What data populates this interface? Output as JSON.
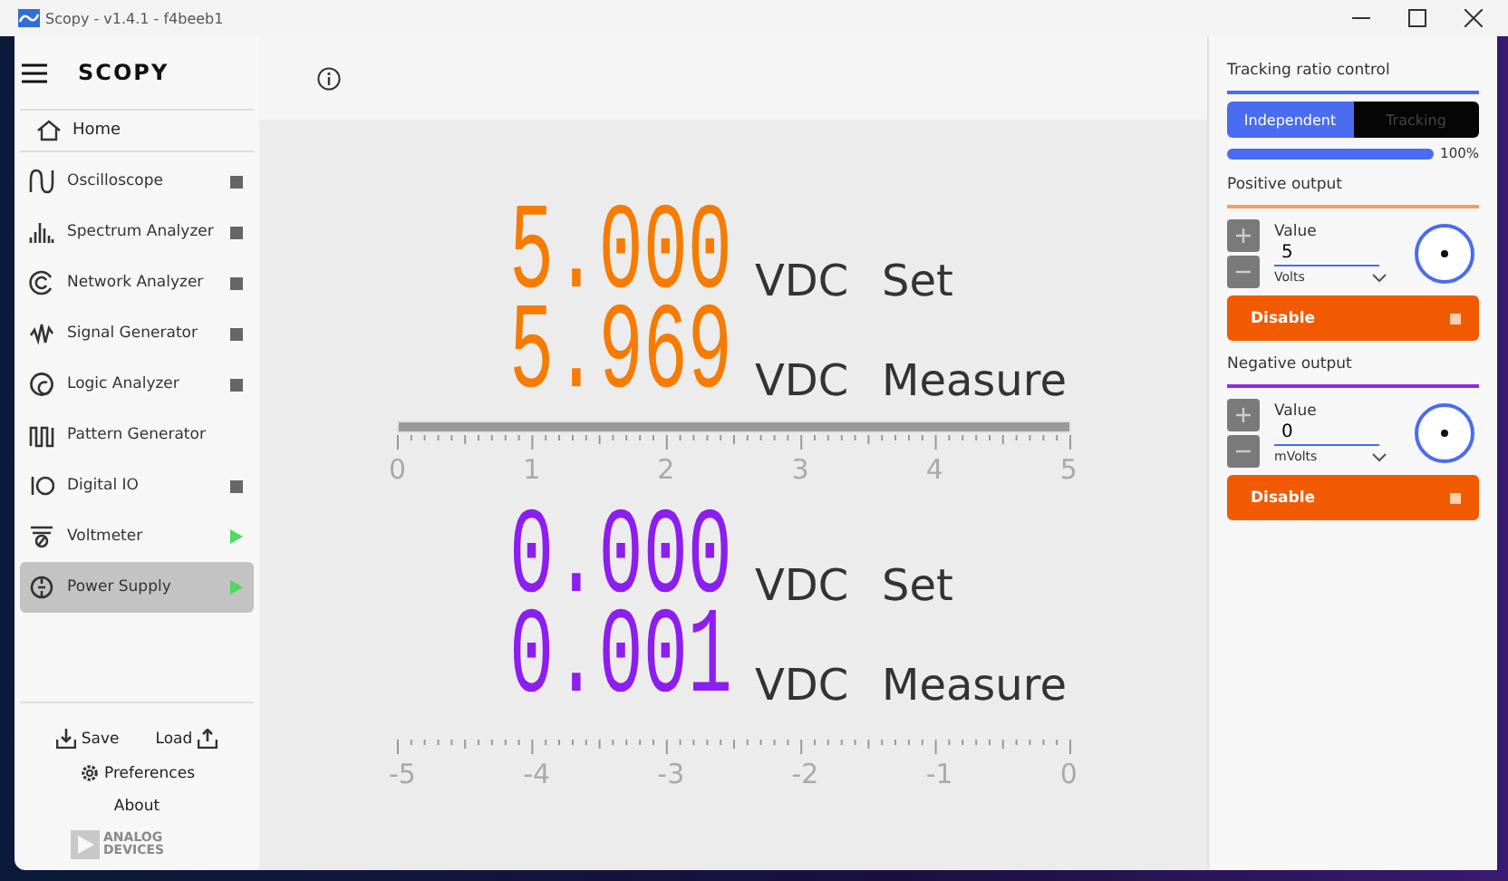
{
  "window": {
    "title": "Scopy - v1.4.1 - f4beeb1"
  },
  "sidebar": {
    "logo": "SCOPY",
    "home": "Home",
    "items": [
      {
        "label": "Oscilloscope",
        "kind": "stopped",
        "selected": false
      },
      {
        "label": "Spectrum Analyzer",
        "kind": "stopped",
        "selected": false
      },
      {
        "label": "Network Analyzer",
        "kind": "stopped",
        "selected": false
      },
      {
        "label": "Signal Generator",
        "kind": "stopped",
        "selected": false
      },
      {
        "label": "Logic Analyzer",
        "kind": "stopped",
        "selected": false
      },
      {
        "label": "Pattern Generator",
        "kind": "plain",
        "selected": false
      },
      {
        "label": "Digital IO",
        "kind": "stopped",
        "selected": false
      },
      {
        "label": "Voltmeter",
        "kind": "running",
        "selected": false
      },
      {
        "label": "Power Supply",
        "kind": "running",
        "selected": true
      }
    ],
    "footer": {
      "save": "Save",
      "load": "Load",
      "preferences": "Preferences",
      "about": "About",
      "brand": "ANALOG DEVICES"
    }
  },
  "displays": [
    {
      "color": "#f57c00",
      "rows": [
        {
          "value": "5.000",
          "unit": "VDC",
          "label": "Set"
        },
        {
          "value": "5.969",
          "unit": "VDC",
          "label": "Measure"
        }
      ],
      "level": 1,
      "scale": [
        "0",
        "1",
        "2",
        "3",
        "4",
        "5"
      ]
    },
    {
      "color": "#8c1ef0",
      "rows": [
        {
          "value": "0.000",
          "unit": "VDC",
          "label": "Set"
        },
        {
          "value": "0.001",
          "unit": "VDC",
          "label": "Measure"
        }
      ],
      "scale": [
        "-5",
        "-4",
        "-3",
        "-2",
        "-1",
        "0"
      ]
    }
  ],
  "tracking": {
    "title": "Tracking ratio control",
    "options": [
      {
        "label": "Independent",
        "selected": true
      },
      {
        "label": "Tracking",
        "selected": false
      }
    ],
    "level": 1,
    "reading": "100%"
  },
  "channels": [
    {
      "title": "Positive output",
      "color": "#f0a060",
      "value_label": "Value",
      "value": "5",
      "unit": "Volts",
      "button": "Disable"
    },
    {
      "title": "Negative output",
      "color": "#8a2be2",
      "value_label": "Value",
      "value": "0",
      "unit": "mVolts",
      "button": "Disable"
    }
  ]
}
